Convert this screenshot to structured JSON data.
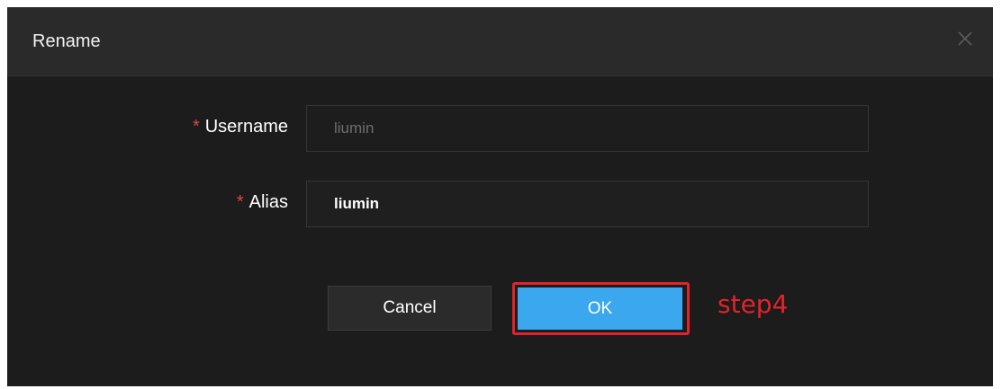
{
  "dialog": {
    "title": "Rename",
    "close_icon": "close-icon"
  },
  "form": {
    "username": {
      "required_mark": "*",
      "label": "Username",
      "value": "liumin",
      "disabled": true
    },
    "alias": {
      "required_mark": "*",
      "label": "Alias",
      "value": "liumin"
    }
  },
  "buttons": {
    "cancel_label": "Cancel",
    "ok_label": "OK"
  },
  "annotation": {
    "step_label": "step4",
    "highlight_color": "#e3232b"
  },
  "colors": {
    "dialog_bg": "#1c1c1c",
    "header_bg": "#2a2a2a",
    "primary": "#3aa7ee",
    "required": "#e04545"
  }
}
